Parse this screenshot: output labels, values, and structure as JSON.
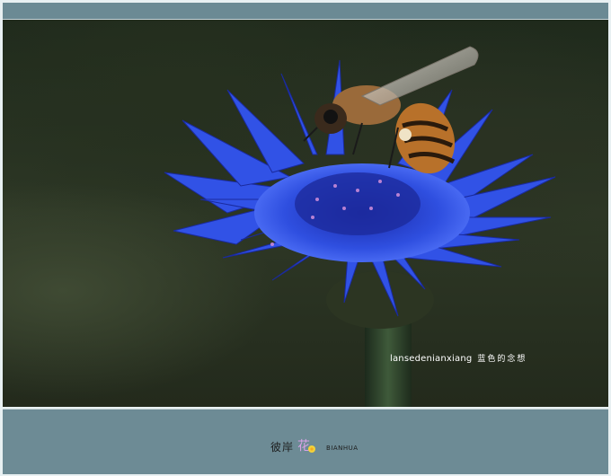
{
  "photo": {
    "subject": "blue-cornflower-with-bee",
    "caption_text": "lansedenianxiang",
    "caption_zh": "蓝色的念想"
  },
  "footer": {
    "logo_text": "彼岸",
    "logo_mark": "花",
    "logo_latin": "BIANHUA"
  },
  "colors": {
    "frame": "#e8f0f2",
    "band": "#6d8b95",
    "flower": "#2f4fe0",
    "background": "#263020"
  }
}
